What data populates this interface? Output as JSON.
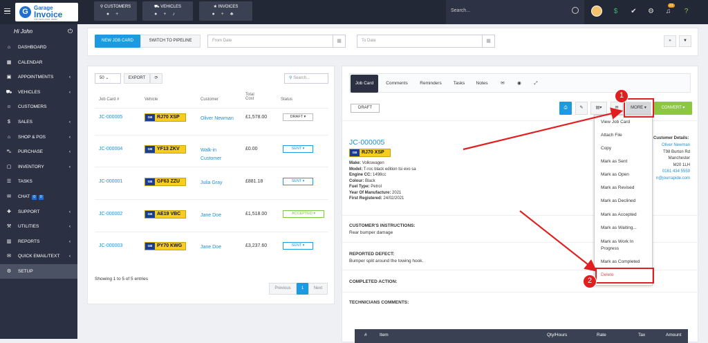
{
  "logo": {
    "line1": "Garage",
    "line2": "Invoice",
    "line3": "Get more done, faster"
  },
  "top_groups": [
    {
      "label": "CUSTOMERS"
    },
    {
      "label": "VEHICLES"
    },
    {
      "label": "INVOICES"
    }
  ],
  "search": {
    "placeholder": "Search..."
  },
  "notification_count": "21",
  "user": {
    "greeting": "Hi John"
  },
  "sidebar": [
    {
      "label": "DASHBOARD",
      "icon": "home-icon"
    },
    {
      "label": "CALENDAR",
      "icon": "calendar-icon"
    },
    {
      "label": "APPOINTMENTS",
      "icon": "appointments-icon",
      "chev": "‹"
    },
    {
      "label": "VEHICLES",
      "icon": "car-icon",
      "chev": "‹"
    },
    {
      "label": "CUSTOMERS",
      "icon": "user-icon"
    },
    {
      "label": "SALES",
      "icon": "dollar-icon",
      "chev": "‹"
    },
    {
      "label": "SHOP & POS",
      "icon": "shop-icon",
      "chev": "‹"
    },
    {
      "label": "PURCHASE",
      "icon": "cart-icon",
      "chev": "‹"
    },
    {
      "label": "INVENTORY",
      "icon": "box-icon",
      "chev": "‹"
    },
    {
      "label": "TASKS",
      "icon": "tasks-icon"
    },
    {
      "label": "CHAT",
      "icon": "chat-icon",
      "badges": [
        "0",
        "0"
      ]
    },
    {
      "label": "SUPPORT",
      "icon": "support-icon",
      "chev": "‹"
    },
    {
      "label": "UTILITIES",
      "icon": "utilities-icon",
      "chev": "‹"
    },
    {
      "label": "REPORTS",
      "icon": "reports-icon",
      "chev": "‹"
    },
    {
      "label": "QUICK EMAIL/TEXT",
      "icon": "email-icon",
      "chev": "‹"
    },
    {
      "label": "SETUP",
      "icon": "gear-icon",
      "active": true
    }
  ],
  "toolbar": {
    "new_job": "NEW JOB CARD",
    "switch": "SWITCH TO PIPELINE",
    "from_date": "From Date",
    "to_date": "To Date"
  },
  "list": {
    "page_size": "50",
    "export": "EXPORT",
    "search_placeholder": "Search...",
    "headers": [
      "Job Card #",
      "Vehicle",
      "Customer",
      "Total Cost",
      "Status"
    ],
    "rows": [
      {
        "job": "JC-000005",
        "plate": "RJ70 XSP",
        "customer": "Oliver Newman",
        "cost": "£1,578.00",
        "status": "DRAFT",
        "type": "draft"
      },
      {
        "job": "JC-000004",
        "plate": "YF13 ZKV",
        "customer": "Walk-in Customer",
        "cost": "£0.00",
        "status": "SENT",
        "type": "sent"
      },
      {
        "job": "JC-000001",
        "plate": "GF63 ZZU",
        "customer": "Julia Gray",
        "cost": "£881.18",
        "status": "SENT",
        "type": "sent"
      },
      {
        "job": "JC-000002",
        "plate": "AE19 VBC",
        "customer": "Jane Doe",
        "cost": "£1,518.00",
        "status": "ACCEPTED",
        "type": "acc"
      },
      {
        "job": "JC-000003",
        "plate": "PY70 KWG",
        "customer": "Jane Doe",
        "cost": "£3,237.60",
        "status": "SENT",
        "type": "sent"
      }
    ],
    "gb": "GB",
    "showing": "Showing 1 to 5 of 5 entries",
    "prev": "Previous",
    "page": "1",
    "next": "Next"
  },
  "detail": {
    "tabs": [
      "Job Card",
      "Comments",
      "Reminders",
      "Tasks",
      "Notes"
    ],
    "status": "DRAFT",
    "more": "MORE",
    "convert": "CONVERT",
    "job": "JC-000005",
    "plate": "RJ70 XSP",
    "specs": [
      {
        "k": "Make:",
        "v": "Volkswagen"
      },
      {
        "k": "Model:",
        "v": "T-roc black edition tsi evo sa"
      },
      {
        "k": "Engine CC:",
        "v": "1498cc"
      },
      {
        "k": "Colour:",
        "v": "Black"
      },
      {
        "k": "Fuel Type:",
        "v": "Petrol"
      },
      {
        "k": "Year Of Manufacture:",
        "v": "2021"
      },
      {
        "k": "First Registered:",
        "v": "24/02/2021"
      }
    ],
    "customer_details": "Customer Details:",
    "customer_lines": [
      "Oliver Newman",
      "T98 Burton Rd",
      "Manchester",
      "M20 1LH",
      "0161 434 5559",
      "n@jourrapide.com"
    ],
    "instructions_label": "CUSTOMER'S INSTRUCTIONS:",
    "instructions": "Rear bumper damage",
    "defect_label": "REPORTED DEFECT:",
    "defect": "Bumper split around the towing hook.",
    "completed_label": "COMPLETED ACTION:",
    "tech_label": "TECHNICIANS COMMENTS:",
    "table_headers": [
      "#",
      "Item",
      "Qty/Hours",
      "Rate",
      "Tax",
      "Amount"
    ]
  },
  "more_menu": [
    "View Job Card",
    "Attach File",
    "Copy",
    "Mark as Sent",
    "Mark as Open",
    "Mark as Revised",
    "Mark as Declined",
    "Mark as Accepted",
    "Mark as Waiting...",
    "Mark as Work In Progress",
    "Mark as Completed",
    "Delete"
  ],
  "callouts": [
    "1",
    "2"
  ]
}
